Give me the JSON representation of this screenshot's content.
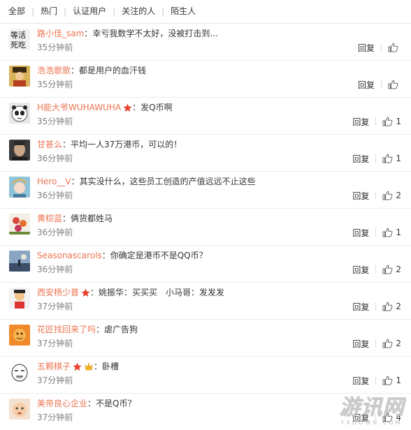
{
  "tabs": [
    {
      "label": "全部"
    },
    {
      "label": "热门"
    },
    {
      "label": "认证用户"
    },
    {
      "label": "关注的人"
    },
    {
      "label": "陌生人"
    }
  ],
  "reply_label": "回复",
  "colors": {
    "username": "#eb7350",
    "time": "#808080",
    "badge_star": "#e8412b"
  },
  "comments": [
    {
      "user": "路小佳_sam",
      "content": "幸亏我数学不太好，没被打击到...",
      "time": "35分钟前",
      "likes": "",
      "avatar": "text-avatar"
    },
    {
      "user": "浩浩歌歌",
      "content": "都是用户的血汗钱",
      "time": "35分钟前",
      "likes": "",
      "avatar": "emperor-avatar"
    },
    {
      "user": "H能大爷WUHAWUHA",
      "content": "发Q币啊",
      "time": "35分钟前",
      "likes": "1",
      "avatar": "panda-avatar",
      "badges": [
        "star"
      ]
    },
    {
      "user": "甘甚么",
      "content": "平均一人37万港币，可以的！",
      "time": "36分钟前",
      "likes": "1",
      "avatar": "portrait-avatar"
    },
    {
      "user": "Hero__V",
      "content": "其实没什么，这些员工创造的产值远远不止这些",
      "time": "36分钟前",
      "likes": "2",
      "avatar": "anime-avatar"
    },
    {
      "user": "黄棕蓝",
      "content": "俩货都姓马",
      "time": "36分钟前",
      "likes": "1",
      "avatar": "flower-avatar"
    },
    {
      "user": "Seasonascarols",
      "content": "你确定是港币不是QQ币？",
      "time": "36分钟前",
      "likes": "2",
      "avatar": "landscape-avatar"
    },
    {
      "user": "西安杨少普",
      "content": "姚振华：买买买　小马哥：发发发",
      "time": "37分钟前",
      "likes": "2",
      "avatar": "cartoon-avatar",
      "badges": [
        "star"
      ]
    },
    {
      "user": "花匠找回来了吗",
      "content": "虐广告狗",
      "time": "37分钟前",
      "likes": "2",
      "avatar": "orange-avatar"
    },
    {
      "user": "五颗棋子",
      "content": "卧槽",
      "time": "37分钟前",
      "likes": "1",
      "avatar": "meme-face-avatar",
      "badges": [
        "star",
        "vip"
      ]
    },
    {
      "user": "美帝良心企业",
      "content": "不是Q币？",
      "time": "37分钟前",
      "likes": "4",
      "avatar": "baby-avatar"
    }
  ],
  "watermark": {
    "main": "游讯网",
    "sub": "YXDOWN.COM"
  }
}
